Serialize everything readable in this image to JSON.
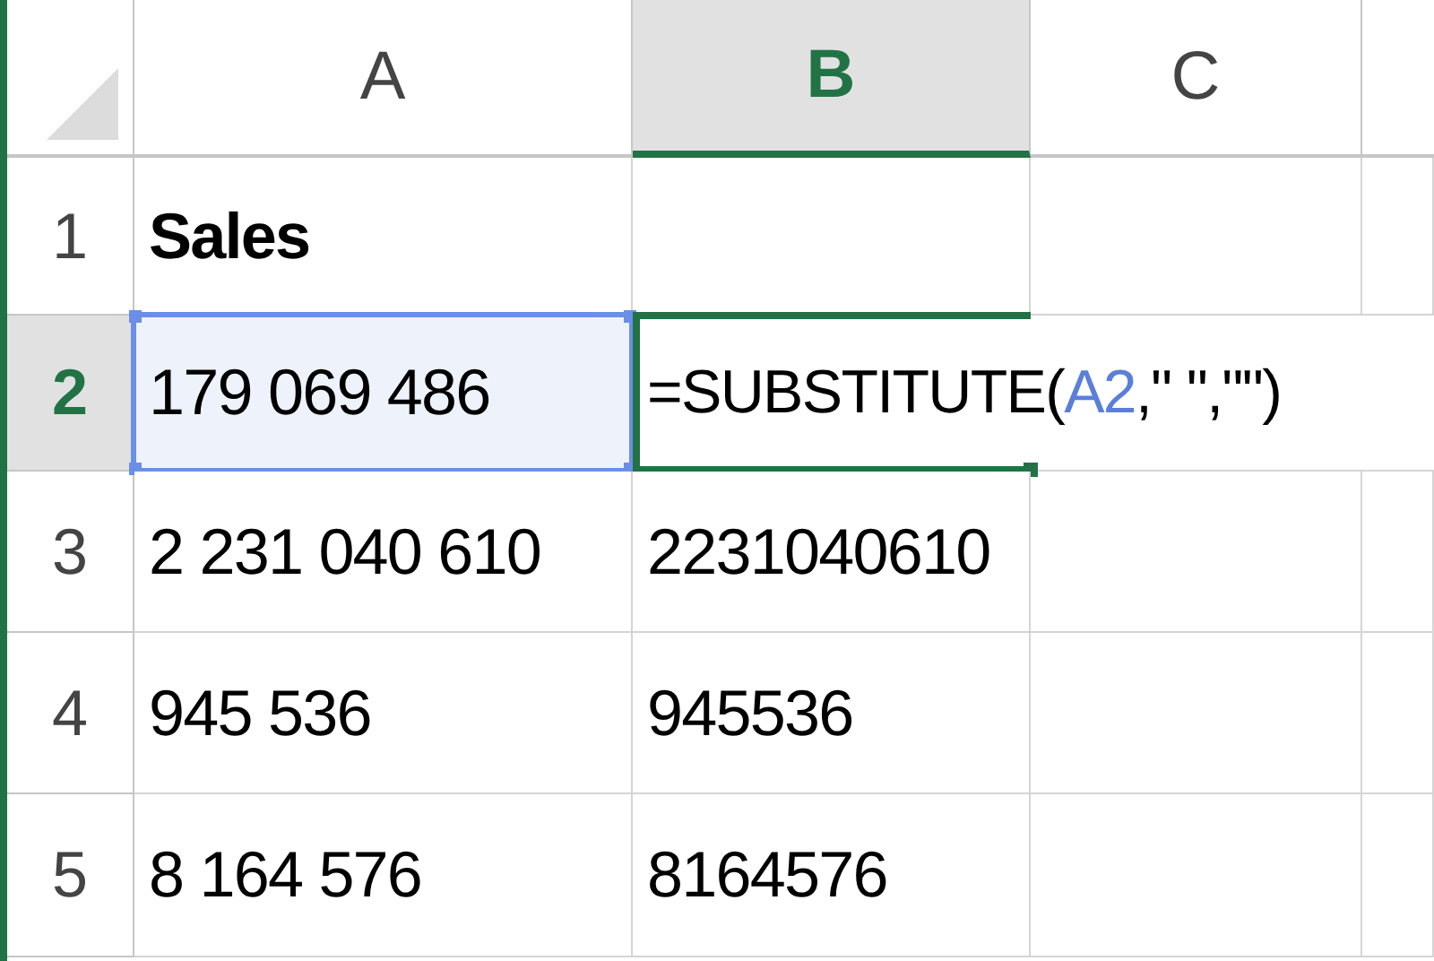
{
  "columns": [
    {
      "label": "A",
      "selected": false
    },
    {
      "label": "B",
      "selected": true
    },
    {
      "label": "C",
      "selected": false
    }
  ],
  "rows": [
    {
      "header": "1",
      "selected": false,
      "cells": [
        {
          "kind": "value",
          "text": "Sales",
          "bold": true,
          "referenced": false
        }
      ]
    },
    {
      "header": "2",
      "selected": true,
      "cells": [
        {
          "kind": "value",
          "text": "179 069 486",
          "bold": false,
          "referenced": true
        },
        {
          "kind": "formula",
          "editing": true,
          "parts": [
            {
              "kind": "text",
              "text": "=SUBSTITUTE("
            },
            {
              "kind": "ref",
              "text": "A2"
            },
            {
              "kind": "text",
              "text": ",\" \",\"\")"
            }
          ]
        }
      ]
    },
    {
      "header": "3",
      "selected": false,
      "cells": [
        {
          "kind": "value",
          "text": "2 231 040 610",
          "bold": false,
          "referenced": false
        },
        {
          "kind": "value",
          "text": "2231040610",
          "bold": false,
          "referenced": false
        }
      ]
    },
    {
      "header": "4",
      "selected": false,
      "cells": [
        {
          "kind": "value",
          "text": "945 536",
          "bold": false,
          "referenced": false
        },
        {
          "kind": "value",
          "text": "945536",
          "bold": false,
          "referenced": false
        }
      ]
    },
    {
      "header": "5",
      "selected": false,
      "cells": [
        {
          "kind": "value",
          "text": "8 164 576",
          "bold": false,
          "referenced": false
        },
        {
          "kind": "value",
          "text": "8164576",
          "bold": false,
          "referenced": false
        }
      ]
    }
  ]
}
